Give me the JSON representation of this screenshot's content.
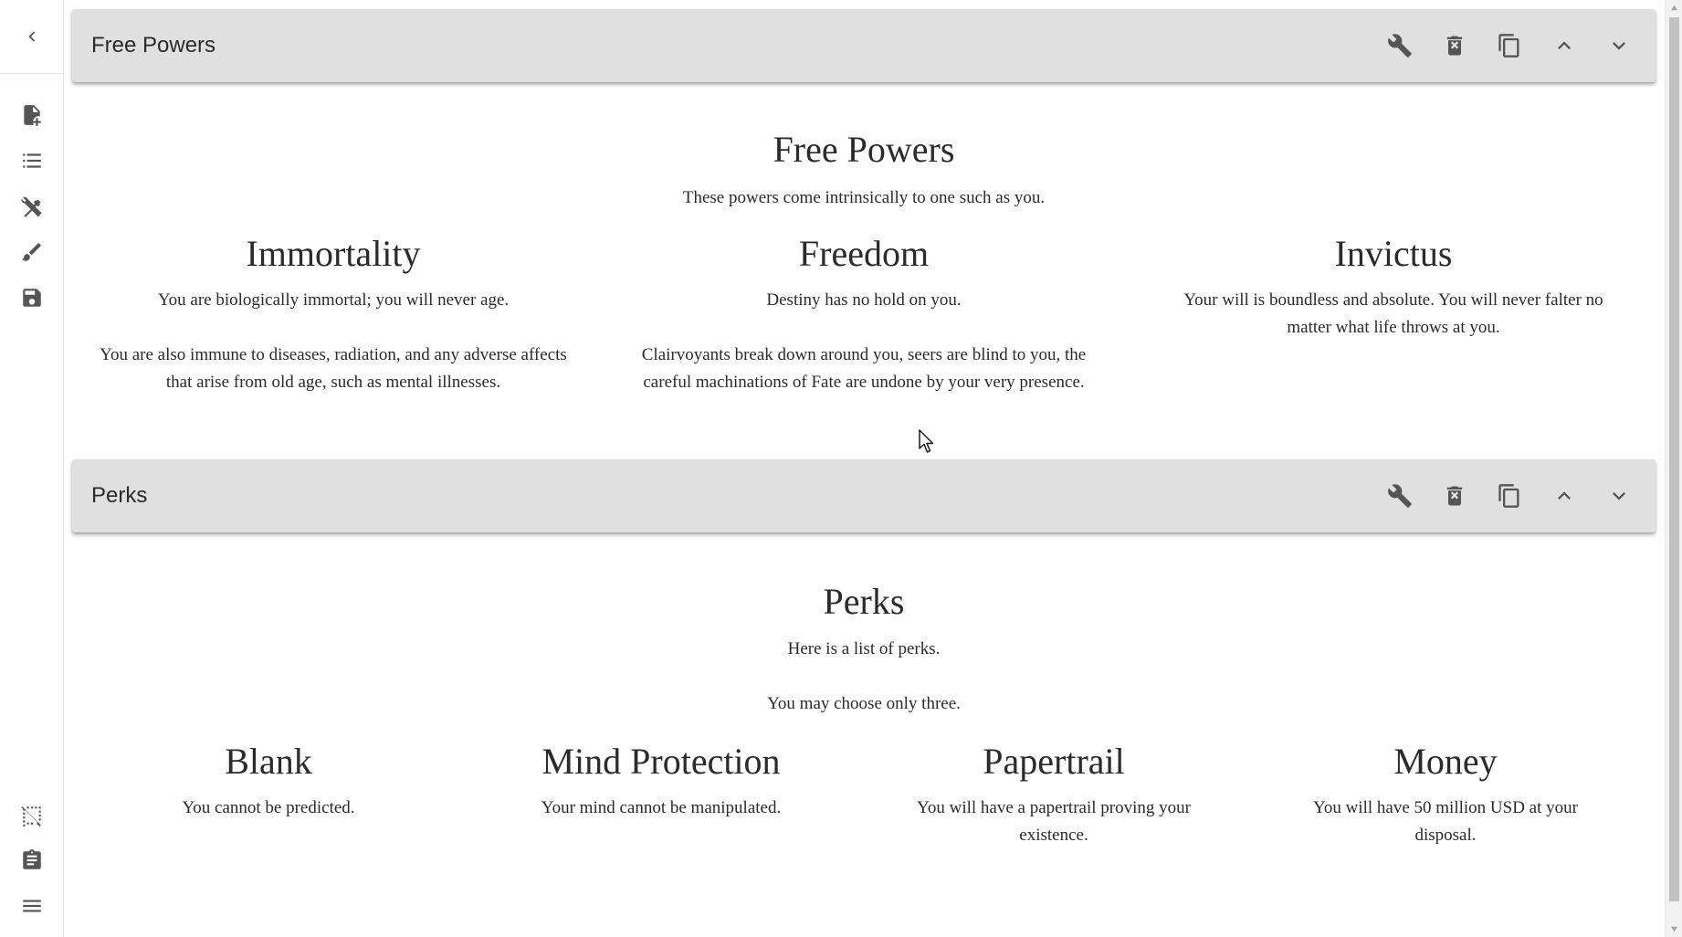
{
  "rail": {
    "icons": [
      "chevron-left-icon",
      "add-document-icon",
      "list-icon",
      "tools-icon",
      "brush-icon",
      "save-icon",
      "selection-off-icon",
      "clipboard-icon",
      "menu-icon"
    ]
  },
  "rows": [
    {
      "header": "Free Powers",
      "title": "Free Powers",
      "description": "These powers come intrinsically to one such as you.",
      "choices": [
        {
          "title": "Immortality",
          "paragraphs": [
            "You are biologically immortal; you will never age.",
            "You are also immune to diseases, radiation, and any adverse affects that arise from old age, such as mental illnesses."
          ]
        },
        {
          "title": "Freedom",
          "paragraphs": [
            "Destiny has no hold on you.",
            "Clairvoyants break down around you, seers are blind to you, the careful machinations of Fate are undone by your very presence."
          ]
        },
        {
          "title": "Invictus",
          "paragraphs": [
            "Your will is boundless and absolute. You will never falter no matter what life throws at you."
          ]
        }
      ]
    },
    {
      "header": "Perks",
      "title": "Perks",
      "description": "Here is a list of perks.",
      "description2": "You may choose only three.",
      "choices": [
        {
          "title": "Blank",
          "paragraphs": [
            "You cannot be predicted."
          ]
        },
        {
          "title": "Mind Protection",
          "paragraphs": [
            "Your mind cannot be manipulated."
          ]
        },
        {
          "title": "Papertrail",
          "paragraphs": [
            "You will have a papertrail proving your existence."
          ]
        },
        {
          "title": "Money",
          "paragraphs": [
            "You will have 50 million USD at your disposal."
          ]
        }
      ]
    }
  ],
  "toolbar_icons": [
    "wrench-icon",
    "delete-icon",
    "copy-icon",
    "chevron-up-icon",
    "chevron-down-icon"
  ],
  "colors": {
    "header_bg": "#e0e0e0",
    "icon": "#555555",
    "text": "#2b2b2b"
  }
}
